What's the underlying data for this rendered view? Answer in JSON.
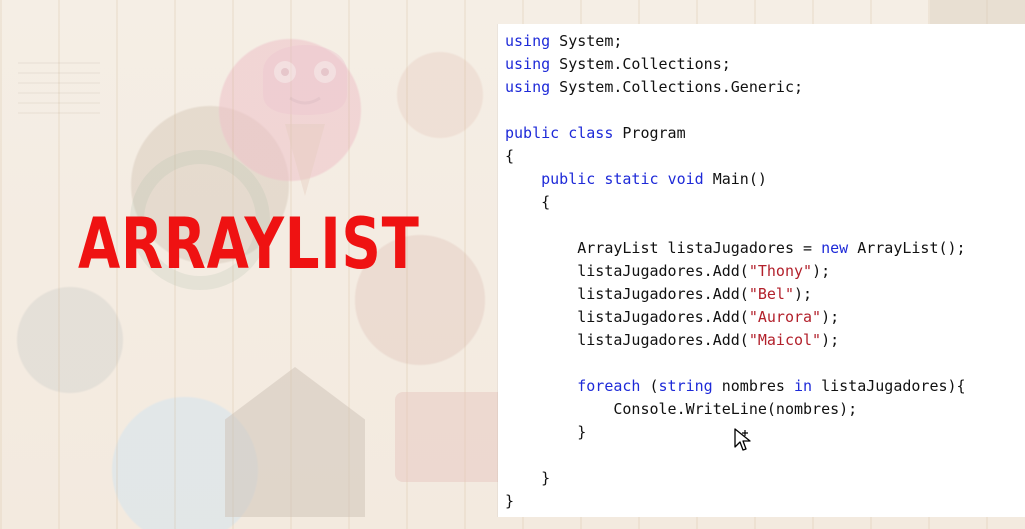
{
  "title": "ARRAYLIST",
  "code": [
    [
      {
        "text": "using",
        "kind": "kw"
      },
      {
        "text": " System;",
        "kind": "plain"
      }
    ],
    [
      {
        "text": "using",
        "kind": "kw"
      },
      {
        "text": " System.Collections;",
        "kind": "plain"
      }
    ],
    [
      {
        "text": "using",
        "kind": "kw"
      },
      {
        "text": " System.Collections.Generic;",
        "kind": "plain"
      }
    ],
    [],
    [
      {
        "text": "public",
        "kind": "kw"
      },
      {
        "text": " ",
        "kind": "plain"
      },
      {
        "text": "class",
        "kind": "kw"
      },
      {
        "text": " Program",
        "kind": "plain"
      }
    ],
    [
      {
        "text": "{",
        "kind": "plain"
      }
    ],
    [
      {
        "text": "    ",
        "kind": "plain"
      },
      {
        "text": "public",
        "kind": "kw"
      },
      {
        "text": " ",
        "kind": "plain"
      },
      {
        "text": "static",
        "kind": "kw"
      },
      {
        "text": " ",
        "kind": "plain"
      },
      {
        "text": "void",
        "kind": "kw"
      },
      {
        "text": " Main()",
        "kind": "plain"
      }
    ],
    [
      {
        "text": "    {",
        "kind": "plain"
      }
    ],
    [],
    [
      {
        "text": "        ArrayList listaJugadores = ",
        "kind": "plain"
      },
      {
        "text": "new",
        "kind": "kw"
      },
      {
        "text": " ArrayList();",
        "kind": "plain"
      }
    ],
    [
      {
        "text": "        listaJugadores.Add(",
        "kind": "plain"
      },
      {
        "text": "\"Thony\"",
        "kind": "str"
      },
      {
        "text": ");",
        "kind": "plain"
      }
    ],
    [
      {
        "text": "        listaJugadores.Add(",
        "kind": "plain"
      },
      {
        "text": "\"Bel\"",
        "kind": "str"
      },
      {
        "text": ");",
        "kind": "plain"
      }
    ],
    [
      {
        "text": "        listaJugadores.Add(",
        "kind": "plain"
      },
      {
        "text": "\"Aurora\"",
        "kind": "str"
      },
      {
        "text": ");",
        "kind": "plain"
      }
    ],
    [
      {
        "text": "        listaJugadores.Add(",
        "kind": "plain"
      },
      {
        "text": "\"Maicol\"",
        "kind": "str"
      },
      {
        "text": ");",
        "kind": "plain"
      }
    ],
    [],
    [
      {
        "text": "        ",
        "kind": "plain"
      },
      {
        "text": "foreach",
        "kind": "kw"
      },
      {
        "text": " (",
        "kind": "plain"
      },
      {
        "text": "string",
        "kind": "kw"
      },
      {
        "text": " nombres ",
        "kind": "plain"
      },
      {
        "text": "in",
        "kind": "kw"
      },
      {
        "text": " listaJugadores){",
        "kind": "plain"
      }
    ],
    [
      {
        "text": "            Console.WriteLine(nombres);",
        "kind": "plain"
      }
    ],
    [
      {
        "text": "        }",
        "kind": "plain"
      }
    ],
    [],
    [
      {
        "text": "    }",
        "kind": "plain"
      }
    ],
    [
      {
        "text": "}",
        "kind": "plain"
      }
    ]
  ],
  "colors": {
    "title": "#ef1212",
    "keyword": "#1e2ad8",
    "string": "#b2202b",
    "text": "#111111",
    "panel": "#ffffff"
  },
  "icons": {
    "cursor": "pointer-cursor-icon"
  }
}
